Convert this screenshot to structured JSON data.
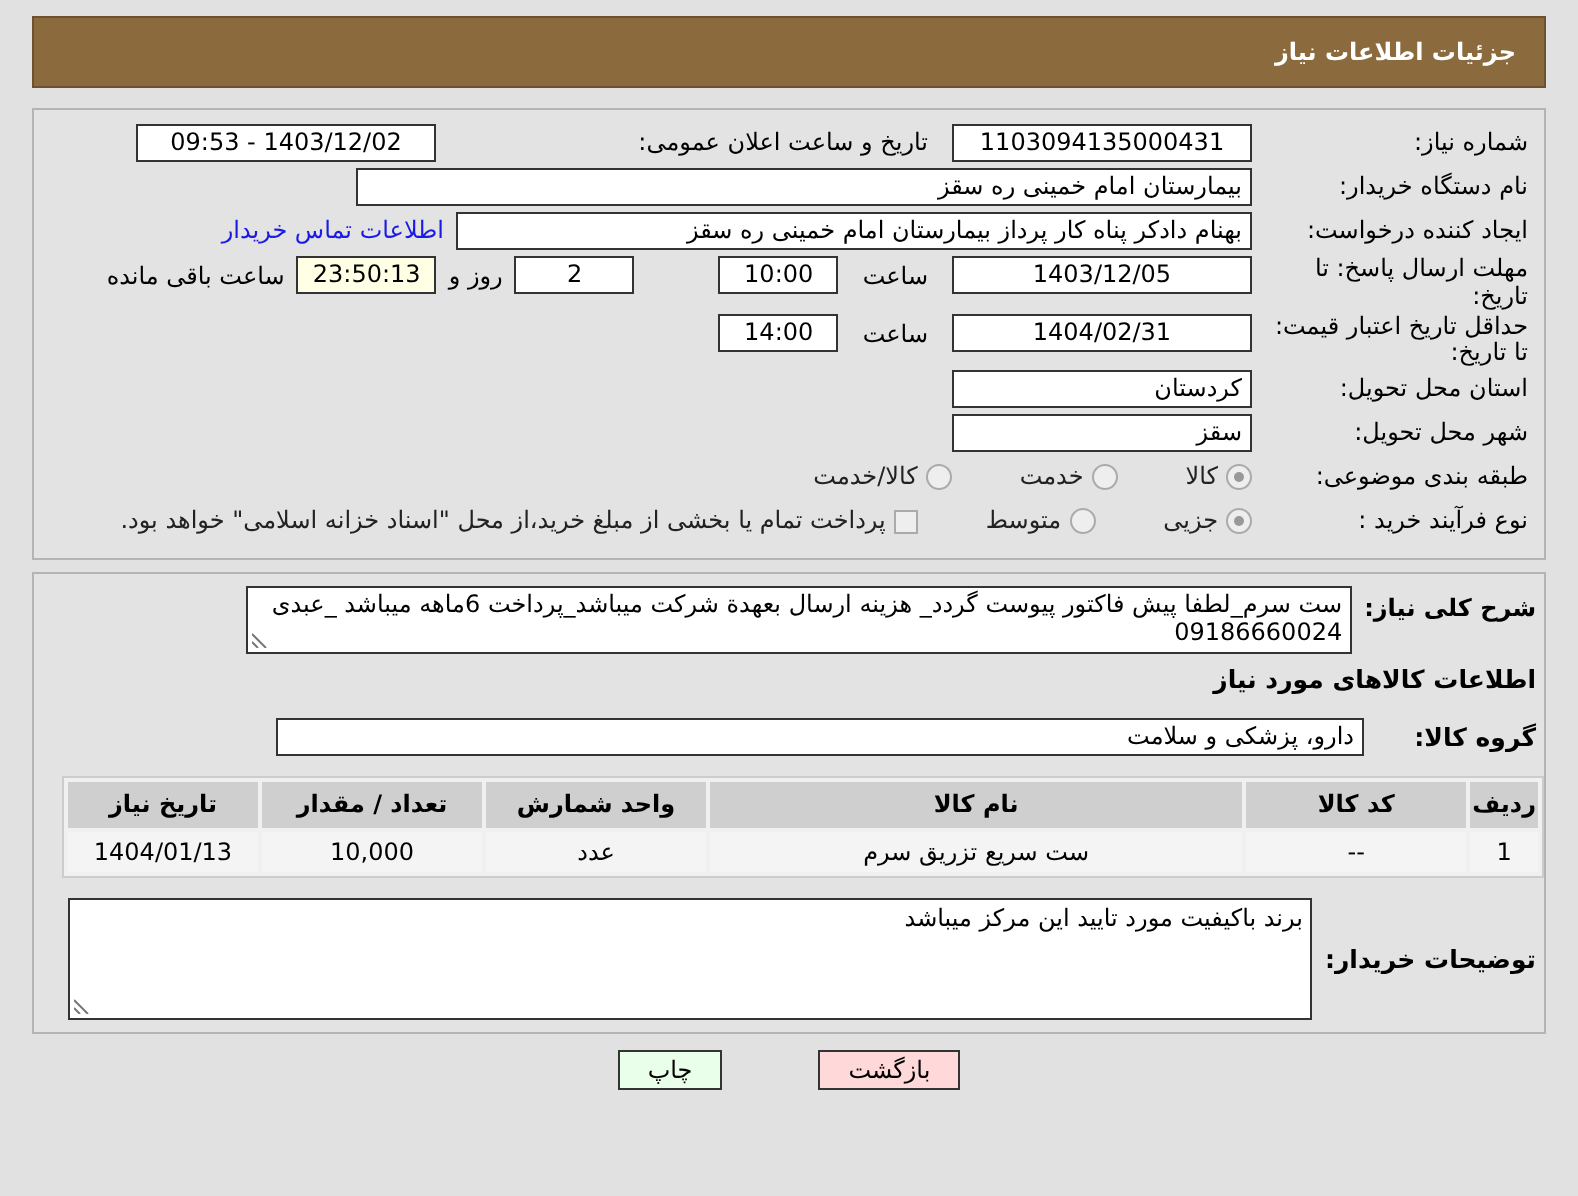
{
  "header": {
    "title": "جزئیات اطلاعات نیاز"
  },
  "need_number": {
    "label": "شماره نیاز:",
    "value": "1103094135000431"
  },
  "announce": {
    "label": "تاریخ و ساعت اعلان عمومی:",
    "value": "1403/12/02 - 09:53"
  },
  "buyer": {
    "label": "نام دستگاه خریدار:",
    "value": "بیمارستان امام خمینی  ره  سقز"
  },
  "creator": {
    "label": "ایجاد کننده درخواست:",
    "value": "بهنام دادکر پناه کار پرداز بیمارستان امام خمینی  ره  سقز",
    "link": "اطلاعات تماس خریدار"
  },
  "reply_deadline": {
    "label": "مهلت ارسال پاسخ: تا تاریخ:",
    "date": "1403/12/05",
    "time_label": "ساعت",
    "time": "10:00",
    "days": "2",
    "days_label": "روز و",
    "remaining": "23:50:13",
    "remaining_label": "ساعت باقی مانده"
  },
  "price_validity": {
    "label": "حداقل تاریخ اعتبار قیمت: تا تاریخ:",
    "date": "1404/02/31",
    "time_label": "ساعت",
    "time": "14:00"
  },
  "province": {
    "label": "استان محل تحویل:",
    "value": "کردستان"
  },
  "city": {
    "label": "شهر محل تحویل:",
    "value": "سقز"
  },
  "category": {
    "label": "طبقه بندی موضوعی:",
    "options": [
      {
        "label": "کالا",
        "selected": true
      },
      {
        "label": "خدمت",
        "selected": false
      },
      {
        "label": "کالا/خدمت",
        "selected": false
      }
    ]
  },
  "process": {
    "label": "نوع فرآیند خرید :",
    "options": [
      {
        "label": "جزیی",
        "selected": true
      },
      {
        "label": "متوسط",
        "selected": false
      }
    ],
    "payment": {
      "label": "پرداخت تمام یا بخشی از مبلغ خرید،از محل \"اسناد خزانه اسلامی\" خواهد بود.",
      "checked": false
    }
  },
  "description": {
    "label": "شرح کلی نیاز:",
    "value": "ست سرم_لطفا پیش فاکتور پیوست گردد_ هزینه ارسال بعهدة شرکت میباشد_پرداخت 6ماهه میباشد _عبدی 09186660024"
  },
  "goods_title": "اطلاعات کالاهای مورد نیاز",
  "goods_group": {
    "label": "گروه کالا:",
    "value": "دارو، پزشکی و سلامت"
  },
  "table": {
    "columns": [
      "ردیف",
      "کد کالا",
      "نام کالا",
      "واحد شمارش",
      "تعداد / مقدار",
      "تاریخ نیاز"
    ],
    "rows": [
      [
        "1",
        "--",
        "ست سریع تزریق سرم",
        "عدد",
        "10,000",
        "1404/01/13"
      ]
    ]
  },
  "buyer_notes": {
    "label": "توضیحات خریدار:",
    "value": "برند باکیفیت مورد تایید این مرکز میباشد"
  },
  "buttons": [
    {
      "kind": "back",
      "label": "بازگشت"
    },
    {
      "kind": "print",
      "label": "چاپ"
    }
  ]
}
